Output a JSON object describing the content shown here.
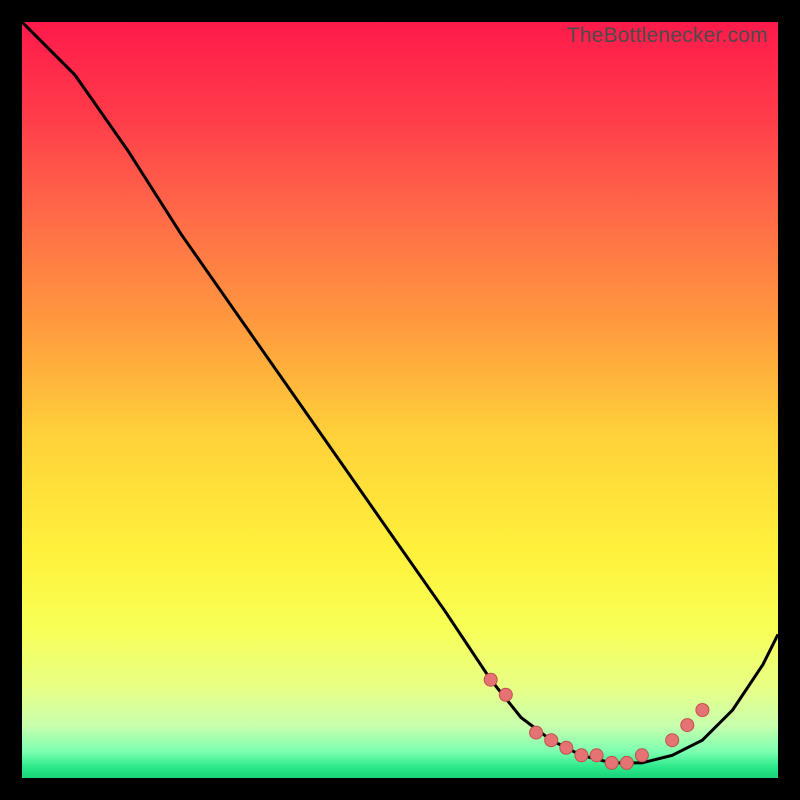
{
  "watermark": "TheBottlenecker.com",
  "colors": {
    "background": "#000000",
    "curve": "#000000",
    "dot_fill": "#e57373",
    "dot_stroke": "#c0504d",
    "gradient_stops": [
      {
        "offset": 0.0,
        "color": "#ff1a4b"
      },
      {
        "offset": 0.12,
        "color": "#ff3a4a"
      },
      {
        "offset": 0.25,
        "color": "#ff6848"
      },
      {
        "offset": 0.4,
        "color": "#ff9a3e"
      },
      {
        "offset": 0.55,
        "color": "#ffd23a"
      },
      {
        "offset": 0.7,
        "color": "#fff13b"
      },
      {
        "offset": 0.8,
        "color": "#f8ff55"
      },
      {
        "offset": 0.88,
        "color": "#e8ff86"
      },
      {
        "offset": 0.93,
        "color": "#c9ffad"
      },
      {
        "offset": 0.965,
        "color": "#7dffb1"
      },
      {
        "offset": 0.985,
        "color": "#2fe98b"
      },
      {
        "offset": 1.0,
        "color": "#17d47a"
      }
    ]
  },
  "chart_data": {
    "type": "line",
    "title": "",
    "xlabel": "",
    "ylabel": "",
    "xlim": [
      0,
      100
    ],
    "ylim": [
      0,
      100
    ],
    "series": [
      {
        "name": "bottleneck-curve",
        "x": [
          0,
          7,
          14,
          21,
          28,
          35,
          42,
          49,
          56,
          62,
          66,
          70,
          74,
          78,
          82,
          86,
          90,
          94,
          98,
          100
        ],
        "y": [
          100,
          93,
          83,
          72,
          62,
          52,
          42,
          32,
          22,
          13,
          8,
          5,
          3,
          2,
          2,
          3,
          5,
          9,
          15,
          19
        ]
      }
    ],
    "dots": {
      "name": "highlight-points",
      "x": [
        62,
        64,
        68,
        70,
        72,
        74,
        76,
        78,
        80,
        82,
        86,
        88,
        90
      ],
      "y": [
        13,
        11,
        6,
        5,
        4,
        3,
        3,
        2,
        2,
        3,
        5,
        7,
        9
      ]
    }
  }
}
